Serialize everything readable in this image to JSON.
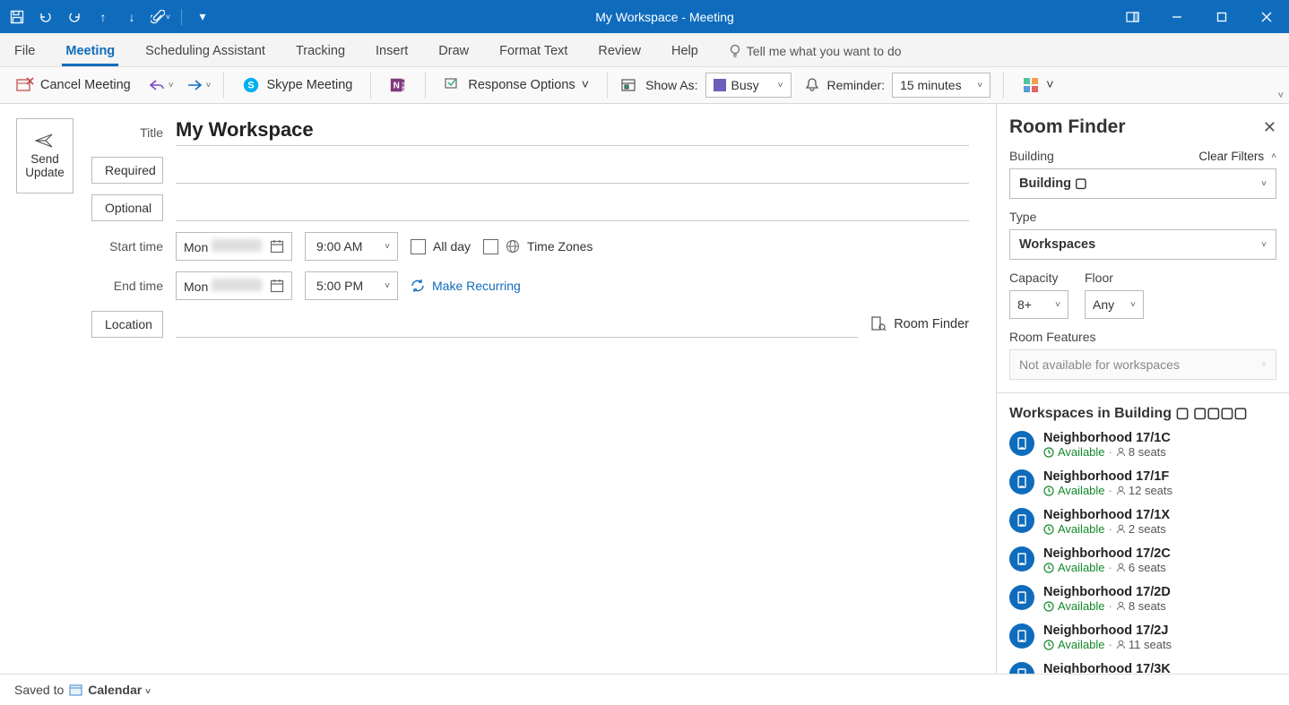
{
  "window": {
    "title": "My Workspace - Meeting"
  },
  "tabs": {
    "file": "File",
    "meeting": "Meeting",
    "scheduling": "Scheduling Assistant",
    "tracking": "Tracking",
    "insert": "Insert",
    "draw": "Draw",
    "format": "Format Text",
    "review": "Review",
    "help": "Help",
    "tellme": "Tell me what you want to do"
  },
  "ribbon": {
    "cancel": "Cancel Meeting",
    "skype": "Skype Meeting",
    "response": "Response Options",
    "showas_label": "Show As:",
    "showas_value": "Busy",
    "reminder_label": "Reminder:",
    "reminder_value": "15 minutes"
  },
  "form": {
    "send": "Send Update",
    "title_label": "Title",
    "title_value": "My Workspace",
    "required": "Required",
    "optional": "Optional",
    "start_label": "Start time",
    "end_label": "End time",
    "start_day": "Mon",
    "end_day": "Mon",
    "start_time": "9:00 AM",
    "end_time": "5:00 PM",
    "allday": "All day",
    "timezones": "Time Zones",
    "recurring": "Make Recurring",
    "location": "Location",
    "roomfinder": "Room Finder"
  },
  "panel": {
    "title": "Room Finder",
    "building_label": "Building",
    "clear": "Clear Filters",
    "building_value": "Building ▢",
    "type_label": "Type",
    "type_value": "Workspaces",
    "capacity_label": "Capacity",
    "capacity_value": "8+",
    "floor_label": "Floor",
    "floor_value": "Any",
    "features_label": "Room Features",
    "features_value": "Not available for workspaces",
    "list_head": "Workspaces in Building ▢ ▢▢▢▢",
    "items": [
      {
        "name": "Neighborhood 17/1C",
        "status": "Available",
        "seats": "8 seats"
      },
      {
        "name": "Neighborhood 17/1F",
        "status": "Available",
        "seats": "12 seats"
      },
      {
        "name": "Neighborhood 17/1X",
        "status": "Available",
        "seats": "2 seats"
      },
      {
        "name": "Neighborhood 17/2C",
        "status": "Available",
        "seats": "6 seats"
      },
      {
        "name": "Neighborhood 17/2D",
        "status": "Available",
        "seats": "8 seats"
      },
      {
        "name": "Neighborhood 17/2J",
        "status": "Available",
        "seats": "11 seats"
      },
      {
        "name": "Neighborhood 17/3K",
        "status": "",
        "seats": ""
      }
    ]
  },
  "status": {
    "saved": "Saved to",
    "calendar": "Calendar"
  }
}
